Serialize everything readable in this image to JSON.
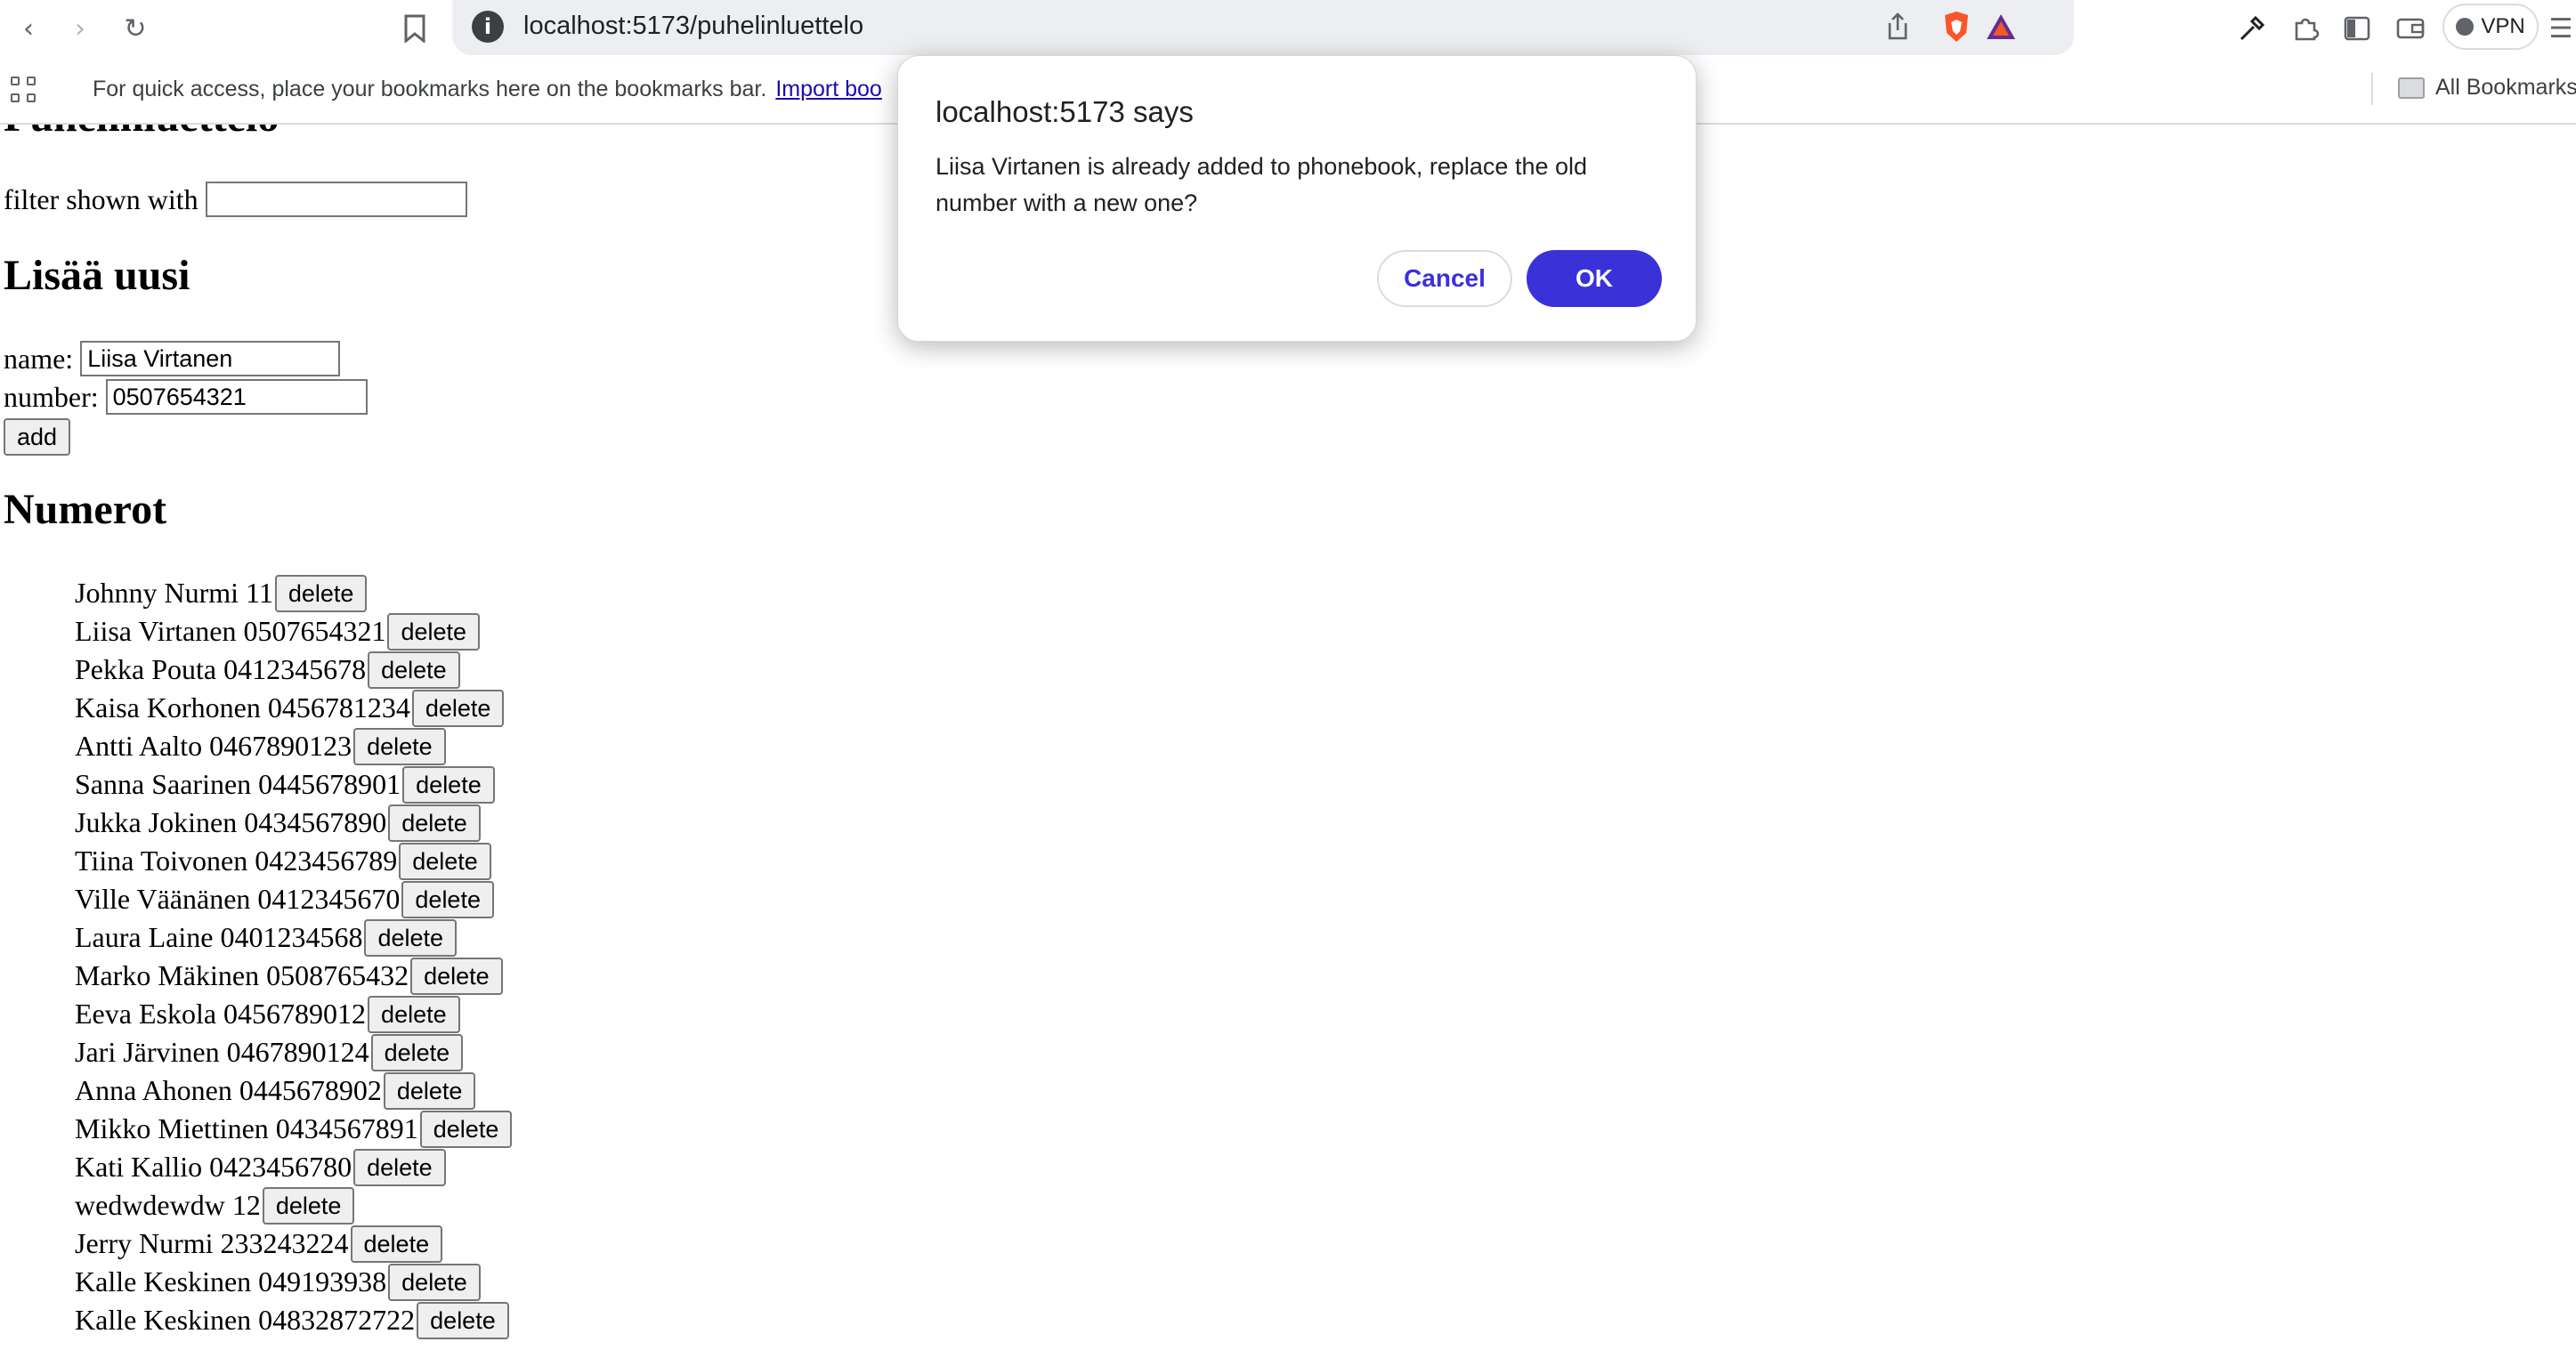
{
  "browser": {
    "url": "localhost:5173/puhelinluettelo",
    "vpn_label": "VPN",
    "icons": [
      "back-icon",
      "forward-icon",
      "reload-icon",
      "bookmark-icon",
      "site-info-icon",
      "share-icon",
      "brave-shields-icon",
      "brave-rewards-icon",
      "eyedropper-icon",
      "extensions-icon",
      "sidebar-icon",
      "wallet-icon",
      "menu-icon"
    ]
  },
  "bookmarks_bar": {
    "hint": "For quick access, place your bookmarks here on the bookmarks bar.",
    "import_link": "Import boo",
    "all_bookmarks": "All Bookmarks"
  },
  "page": {
    "title": "Puhelinluettelo",
    "filter_label": "filter shown with",
    "filter_value": "",
    "add_heading": "Lisää uusi",
    "name_label": "name:",
    "name_value": "Liisa Virtanen",
    "number_label": "number:",
    "number_value": "0507654321",
    "add_button": "add",
    "numbers_heading": "Numerot",
    "delete_label": "delete",
    "contacts": [
      {
        "text": "Johnny Nurmi 11"
      },
      {
        "text": "Liisa Virtanen 0507654321"
      },
      {
        "text": "Pekka Pouta 0412345678"
      },
      {
        "text": "Kaisa Korhonen 0456781234"
      },
      {
        "text": "Antti Aalto 0467890123"
      },
      {
        "text": "Sanna Saarinen 0445678901"
      },
      {
        "text": "Jukka Jokinen 0434567890"
      },
      {
        "text": "Tiina Toivonen 0423456789"
      },
      {
        "text": "Ville Väänänen 0412345670"
      },
      {
        "text": "Laura Laine 0401234568"
      },
      {
        "text": "Marko Mäkinen 0508765432"
      },
      {
        "text": "Eeva Eskola 0456789012"
      },
      {
        "text": "Jari Järvinen 0467890124"
      },
      {
        "text": "Anna Ahonen 0445678902"
      },
      {
        "text": "Mikko Miettinen 0434567891"
      },
      {
        "text": "Kati Kallio 0423456780"
      },
      {
        "text": "wedwdewdw 12"
      },
      {
        "text": "Jerry Nurmi 233243224"
      },
      {
        "text": "Kalle Keskinen 049193938"
      },
      {
        "text": "Kalle Keskinen 04832872722"
      }
    ]
  },
  "dialog": {
    "title": "localhost:5173 says",
    "message": "Liisa Virtanen is already added to phonebook, replace the old number with a new one?",
    "cancel": "Cancel",
    "ok": "OK"
  },
  "colors": {
    "dialog_accent": "#3a31d8",
    "link": "#1a0dab"
  }
}
